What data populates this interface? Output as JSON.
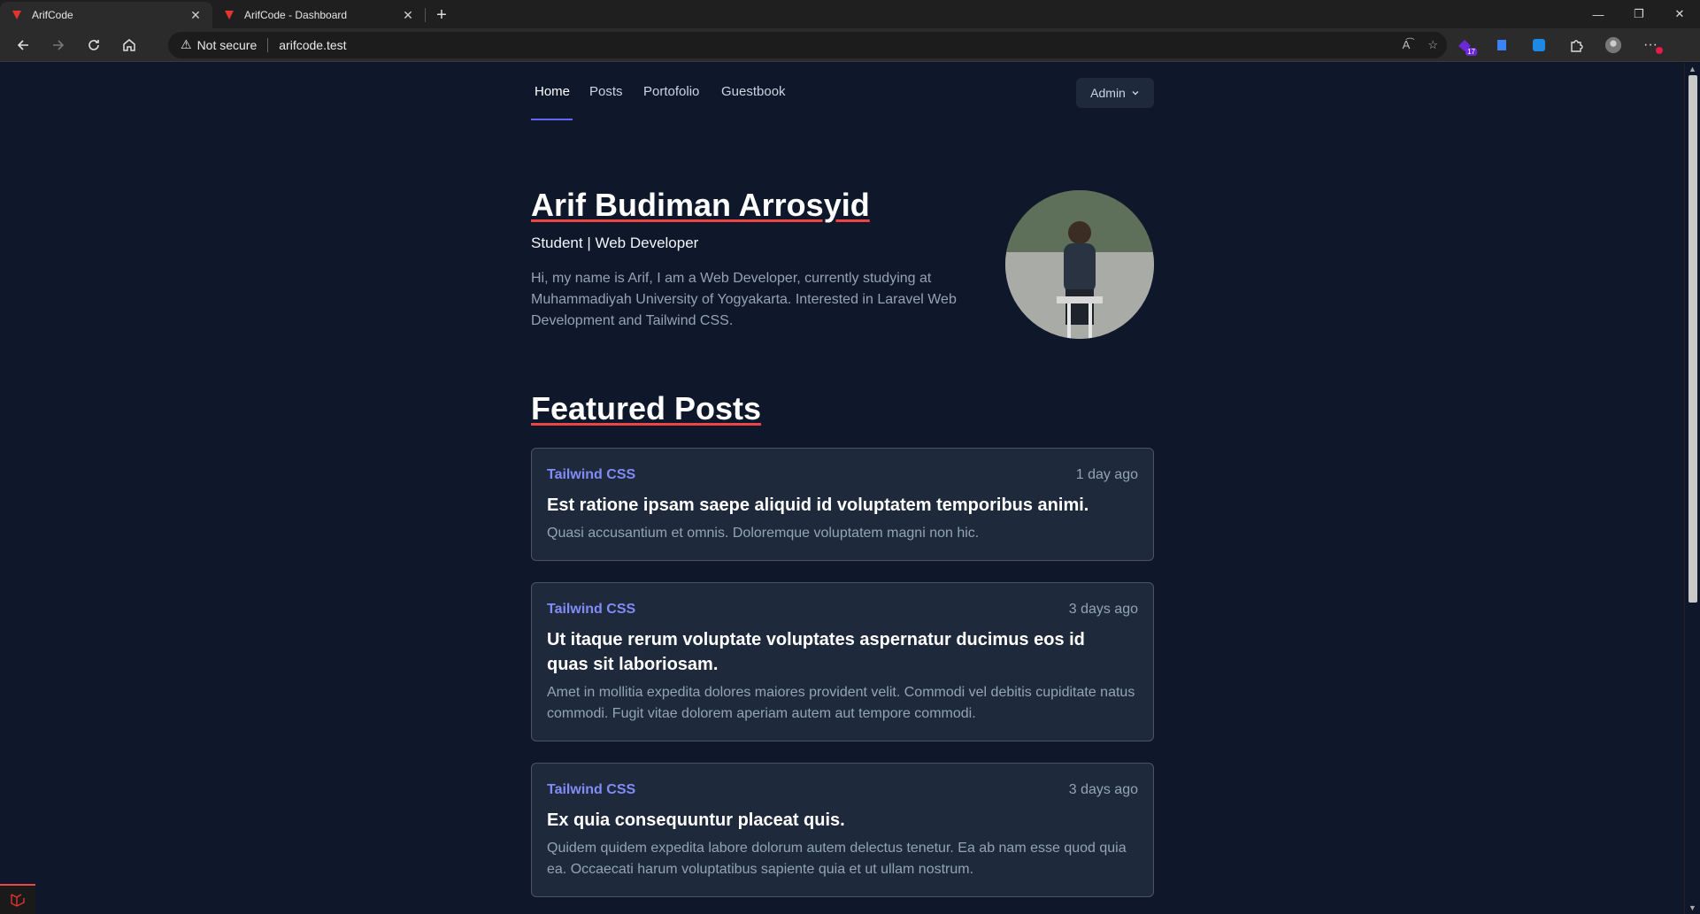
{
  "browser": {
    "tabs": [
      {
        "title": "ArifCode",
        "active": true
      },
      {
        "title": "ArifCode - Dashboard",
        "active": false
      }
    ],
    "security_label": "Not secure",
    "url": "arifcode.test",
    "extension_badge": "17"
  },
  "nav": {
    "links": [
      "Home",
      "Posts",
      "Portofolio",
      "Guestbook"
    ],
    "active": "Home",
    "admin_label": "Admin"
  },
  "hero": {
    "name": "Arif Budiman Arrosyid",
    "role": "Student | Web Developer",
    "bio": "Hi, my name is Arif, I am a Web Developer, currently studying at Muhammadiyah University of Yogyakarta. Interested in Laravel Web Development and Tailwind CSS."
  },
  "featured": {
    "heading": "Featured Posts",
    "posts": [
      {
        "category": "Tailwind CSS",
        "date": "1 day ago",
        "title": "Est ratione ipsam saepe aliquid id voluptatem temporibus animi.",
        "excerpt": "Quasi accusantium et omnis. Doloremque voluptatem magni non hic."
      },
      {
        "category": "Tailwind CSS",
        "date": "3 days ago",
        "title": "Ut itaque rerum voluptate voluptates aspernatur ducimus eos id quas sit laboriosam.",
        "excerpt": "Amet in mollitia expedita dolores maiores provident velit. Commodi vel debitis cupiditate natus commodi. Fugit vitae dolorem aperiam autem aut tempore commodi."
      },
      {
        "category": "Tailwind CSS",
        "date": "3 days ago",
        "title": "Ex quia consequuntur placeat quis.",
        "excerpt": "Quidem quidem expedita labore dolorum autem delectus tenetur. Ea ab nam esse quod quia ea. Occaecati harum voluptatibus sapiente quia et ut ullam nostrum."
      }
    ]
  },
  "colors": {
    "background": "#0f172a",
    "card": "#1e293b",
    "accent": "#818cf8",
    "underline": "#ef4444"
  }
}
